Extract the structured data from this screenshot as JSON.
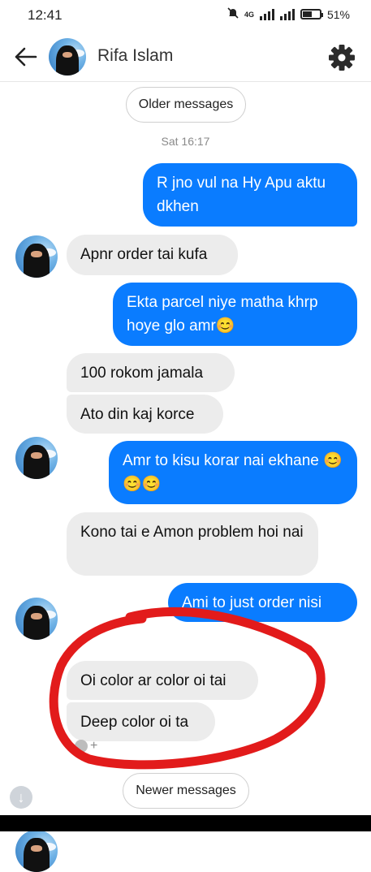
{
  "status_bar": {
    "time": "12:41",
    "battery": "51%",
    "battery_level": 0.51,
    "network": "4G"
  },
  "header": {
    "contact_name": "Rifa Islam"
  },
  "controls": {
    "older_label": "Older messages",
    "newer_label": "Newer messages",
    "timestamp": "Sat 16:17"
  },
  "messages": [
    {
      "dir": "out",
      "text": "R jno vul na Hy Apu aktu dkhen"
    },
    {
      "dir": "in",
      "text": "Apnr order tai kufa"
    },
    {
      "dir": "out",
      "text": "Ekta parcel niye matha khrp hoye glo amr😊"
    },
    {
      "dir": "in",
      "text": "100 rokom jamala"
    },
    {
      "dir": "in",
      "text": "Ato din kaj korce"
    },
    {
      "dir": "out",
      "text": "Amr to kisu korar nai ekhane 😊😊😊"
    },
    {
      "dir": "in",
      "text": "Kono tai e Amon problem hoi nai"
    },
    {
      "dir": "out",
      "text": "Ami to just order nisi"
    },
    {
      "dir": "in",
      "text": "Oi color ar color oi tai"
    },
    {
      "dir": "in",
      "text": "Deep color oi ta"
    }
  ],
  "reaction": {
    "add_label": "+"
  },
  "colors": {
    "outgoing": "#0a7cff",
    "incoming": "#ececec",
    "annotation": "#e21b1b"
  }
}
